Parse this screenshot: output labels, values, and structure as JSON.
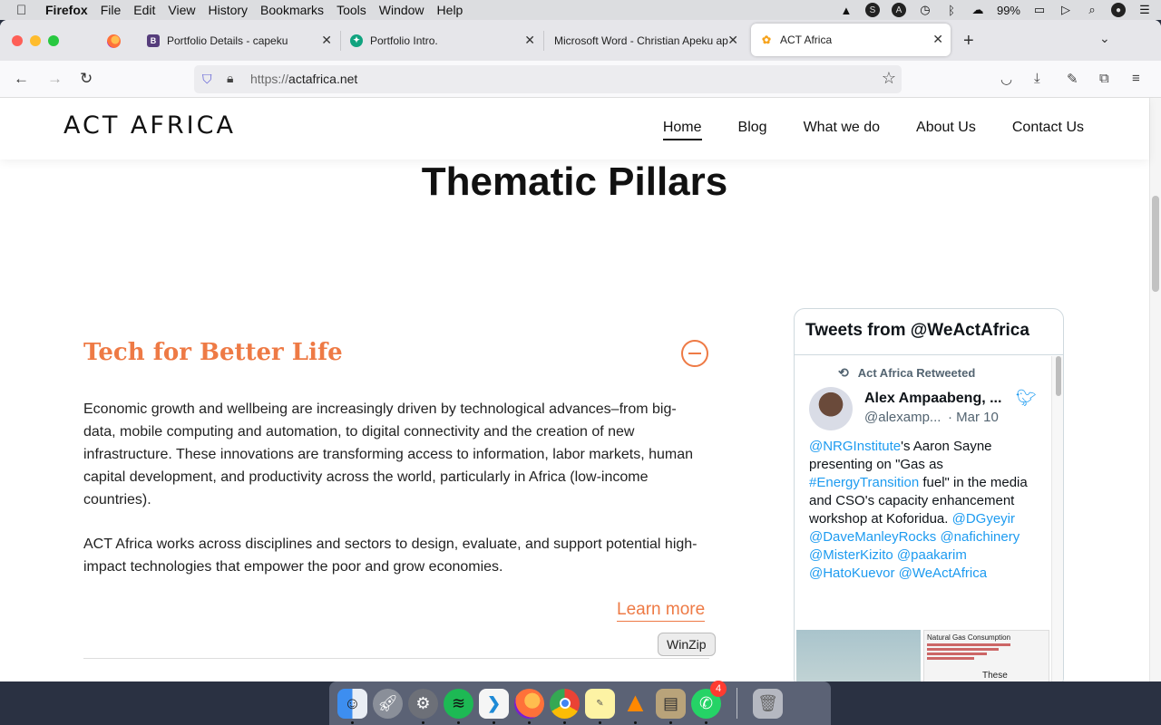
{
  "menubar": {
    "app_name": "Firefox",
    "items": [
      "File",
      "Edit",
      "View",
      "History",
      "Bookmarks",
      "Tools",
      "Window",
      "Help"
    ],
    "battery": "99%"
  },
  "browser": {
    "tabs": [
      {
        "label": "Portfolio Details - capeku",
        "favicon": "B",
        "color": "#563d7c"
      },
      {
        "label": "Portfolio Intro.",
        "favicon": "✦",
        "color": "#10a37f"
      },
      {
        "label": "Microsoft Word - Christian Apeku ap",
        "favicon": "",
        "color": "#ffffff"
      },
      {
        "label": "ACT Africa",
        "favicon": "✿",
        "color": "#f6a21a"
      }
    ],
    "url_protocol": "https://",
    "url_host": "actafrica.net"
  },
  "site": {
    "logo": "ACT AFRICA",
    "nav": [
      "Home",
      "Blog",
      "What we do",
      "About Us",
      "Contact Us"
    ],
    "section_title": "Thematic Pillars",
    "pillar_title": "Tech for Better Life",
    "paragraph_1": "Economic growth and wellbeing are increasingly driven by technological advances–from big-data, mobile computing and automation, to digital connectivity and the creation of new infrastructure. These innovations are transforming access to information, labor markets, human capital development, and productivity across the world, particularly in Africa (low-income countries).",
    "paragraph_2": "ACT Africa works across disciplines and sectors to design, evaluate, and support potential high-impact technologies that empower the poor and grow economies.",
    "learn_more": "Learn more"
  },
  "twitter": {
    "title": "Tweets from @WeActAfrica",
    "retweet_label": "Act Africa Retweeted",
    "author_name": "Alex Ampaabeng, ...",
    "author_handle": "@alexamp...",
    "date": "· Mar 10",
    "text_parts": {
      "mention1": "@NRGInstitute",
      "t1": "'s Aaron Sayne presenting on \"Gas as ",
      "hashtag": "#EnergyTransition",
      "t2": " fuel\" in the media and CSO's capacity enhancement workshop at Koforidua.",
      "mentions2": "@DGyeyir @DaveManleyRocks @nafichinery @MisterKizito @paakarim @HatoKuevor @WeActAfrica"
    },
    "media_caption_1": "Natural Gas Consumption",
    "media_caption_2": "These"
  },
  "dock": {
    "tooltip": "WinZip",
    "whatsapp_badge": "4",
    "apps": [
      "finder",
      "launchpad",
      "system-preferences",
      "spotify",
      "vscode",
      "firefox",
      "chrome",
      "stickies",
      "vlc",
      "winzip",
      "whatsapp",
      "trash"
    ]
  },
  "colors": {
    "accent": "#ee7a45",
    "twitter_blue": "#1d9bf0"
  }
}
